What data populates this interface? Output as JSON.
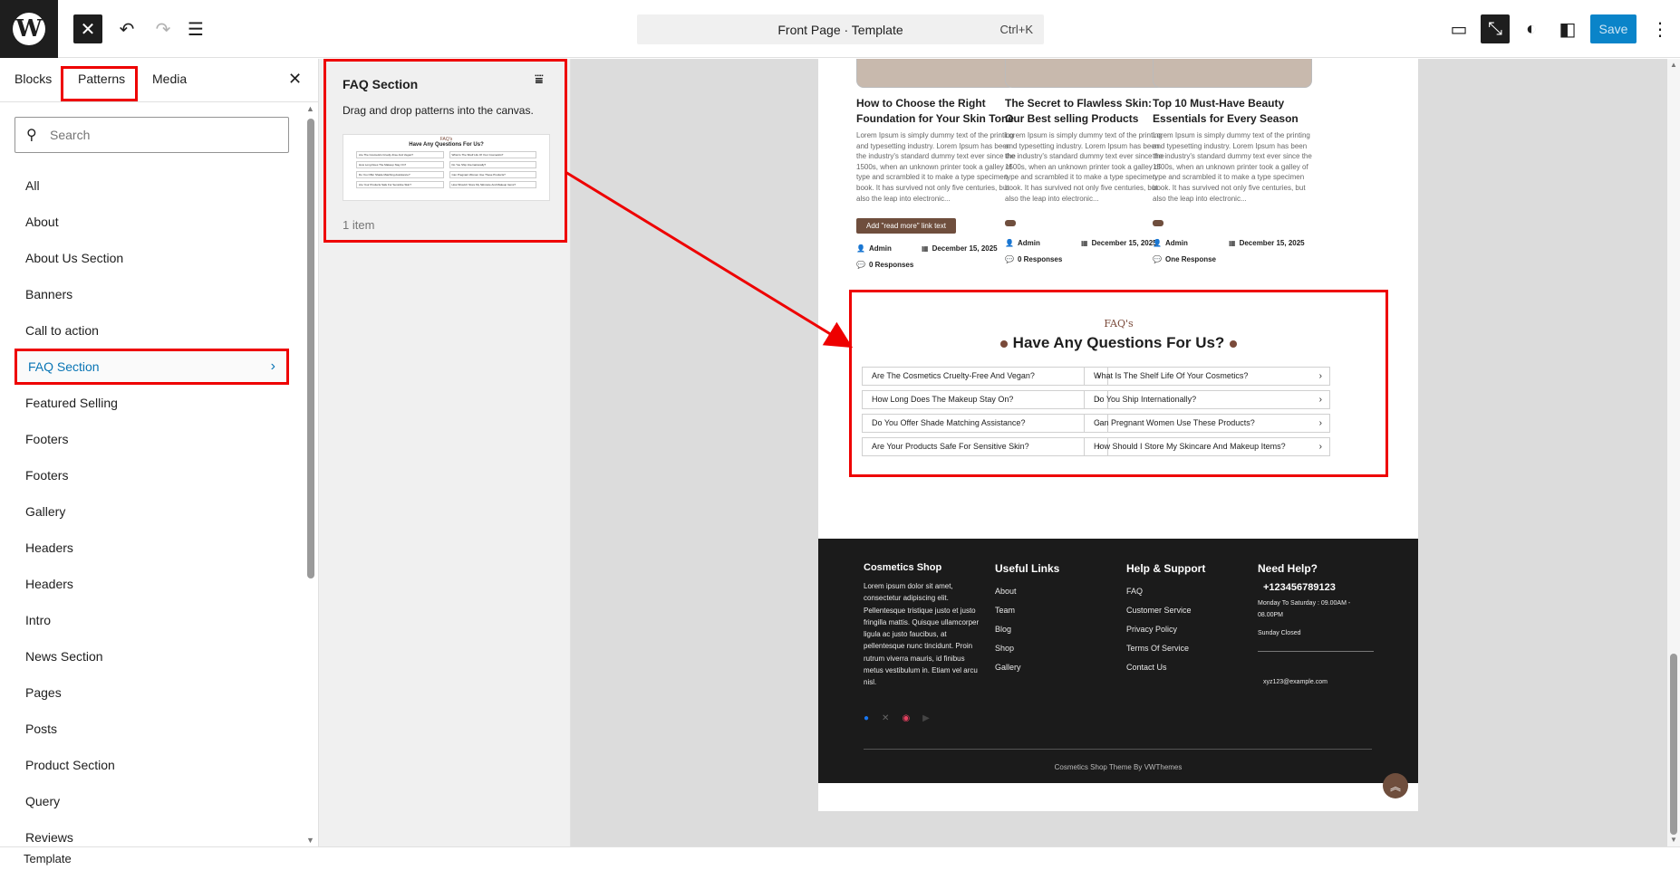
{
  "topbar": {
    "command_bar_label": "Front Page · Template",
    "command_bar_shortcut": "Ctrl+K",
    "save_label": "Save"
  },
  "sidebar": {
    "tabs": [
      "Blocks",
      "Patterns",
      "Media"
    ],
    "active_tab": "Patterns",
    "search_placeholder": "Search",
    "categories": [
      "All",
      "About",
      "About Us Section",
      "Banners",
      "Call to action",
      "FAQ Section",
      "Featured Selling",
      "Footers",
      "Footers",
      "Gallery",
      "Headers",
      "Headers",
      "Intro",
      "News Section",
      "Pages",
      "Posts",
      "Product Section",
      "Query",
      "Reviews"
    ],
    "active_category": "FAQ Section"
  },
  "pattern_panel": {
    "title": "FAQ Section",
    "description": "Drag and drop patterns into the canvas.",
    "count": "1 item"
  },
  "posts": [
    {
      "title": "How to Choose the Right Foundation for Your Skin Tone",
      "excerpt": "Lorem Ipsum is simply dummy text of the printing and typesetting industry. Lorem Ipsum has been the industry's standard dummy text ever since the 1500s, when an unknown printer took a galley of type and scrambled it to make a type specimen book. It has survived not only five centuries, but also the leap into electronic...",
      "button": "Add \"read more\" link text",
      "author": "Admin",
      "date": "December 15, 2025",
      "responses": "0 Responses"
    },
    {
      "title": "The Secret to Flawless Skin: Our Best selling Products",
      "excerpt": "Lorem Ipsum is simply dummy text of the printing and typesetting industry. Lorem Ipsum has been the industry's standard dummy text ever since the 1500s, when an unknown printer took a galley of type and scrambled it to make a type specimen book. It has survived not only five centuries, but also the leap into electronic...",
      "author": "Admin",
      "date": "December 15, 2025",
      "responses": "0 Responses"
    },
    {
      "title": "Top 10 Must-Have Beauty Essentials for Every Season",
      "excerpt": "Lorem Ipsum is simply dummy text of the printing and typesetting industry. Lorem Ipsum has been the industry's standard dummy text ever since the 1500s, when an unknown printer took a galley of type and scrambled it to make a type specimen book. It has survived not only five centuries, but also the leap into electronic...",
      "author": "Admin",
      "date": "December 15, 2025",
      "responses": "One Response"
    }
  ],
  "faq": {
    "eyebrow": "FAQ's",
    "heading": "Have Any Questions For Us?",
    "left": [
      "Are The Cosmetics Cruelty-Free And Vegan?",
      "How Long Does The Makeup Stay On?",
      "Do You Offer Shade Matching Assistance?",
      "Are Your Products Safe For Sensitive Skin?"
    ],
    "right": [
      "What Is The Shelf Life Of Your Cosmetics?",
      "Do You Ship Internationally?",
      "Can Pregnant Women Use These Products?",
      "How Should I Store My Skincare And Makeup Items?"
    ]
  },
  "footer": {
    "brand": "Cosmetics Shop",
    "about": "Lorem ipsum dolor sit amet, consectetur adipiscing elit. Pellentesque tristique justo et justo fringilla mattis. Quisque ullamcorper ligula ac justo faucibus, at pellentesque nunc tincidunt. Proin rutrum viverra mauris, id finibus metus vestibulum in. Etiam vel arcu nisl.",
    "useful_title": "Useful Links",
    "useful": [
      "About",
      "Team",
      "Blog",
      "Shop",
      "Gallery"
    ],
    "help_title": "Help & Support",
    "help": [
      "FAQ",
      "Customer Service",
      "Privacy Policy",
      "Terms Of Service",
      "Contact Us"
    ],
    "need_title": "Need Help?",
    "phone": "+123456789123",
    "hours": "Monday To Saturday : 09.00AM - 08.00PM",
    "closed": "Sunday Closed",
    "email": "xyz123@example.com",
    "copyright": "Cosmetics Shop Theme By VWThemes"
  },
  "status": {
    "label": "Template"
  },
  "colors": {
    "highlight": "#ee0000",
    "accent_brown": "#6f4e3d",
    "save_blue": "#0a84c9",
    "link_blue": "#0a75b5"
  }
}
